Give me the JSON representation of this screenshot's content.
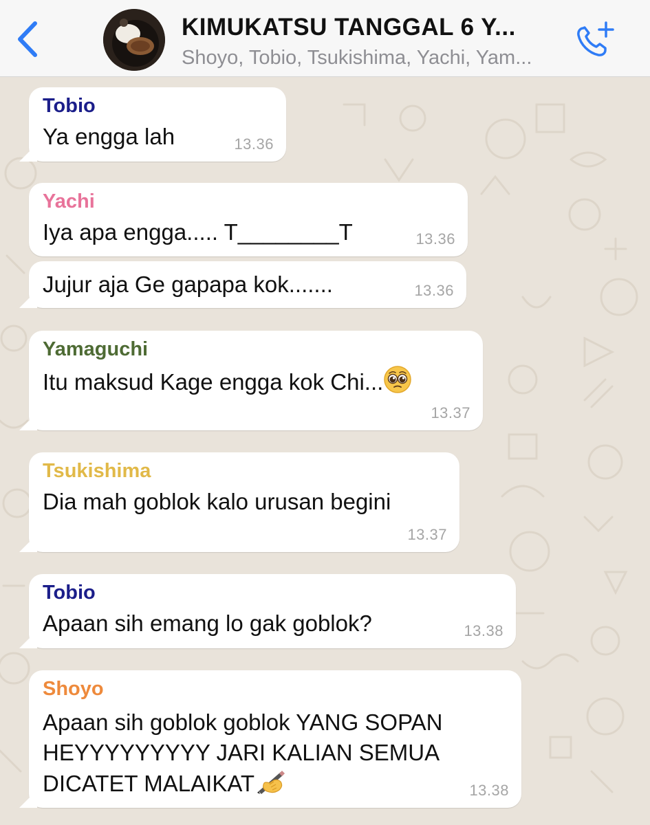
{
  "header": {
    "title": "KIMUKATSU TANGGAL 6 Y...",
    "members": "Shoyo, Tobio, Tsukishima, Yachi, Yam..."
  },
  "colors": {
    "accent": "#2f7cf6",
    "tobio": "#1b1e8a",
    "yachi": "#e8739a",
    "yamaguchi": "#4e6b34",
    "tsukishima": "#e1b948",
    "shoyo": "#ee8a3c"
  },
  "messages": [
    {
      "sender": "Tobio",
      "text": "Ya engga lah",
      "time": "13.36"
    },
    {
      "sender": "Yachi",
      "text": "Iya apa engga..... T________T",
      "time": "13.36"
    },
    {
      "sender": "",
      "text": "Jujur aja Ge gapapa kok.......",
      "time": "13.36"
    },
    {
      "sender": "Yamaguchi",
      "text": "Itu maksud Kage engga kok Chi...",
      "emoji": "pleading-face-icon",
      "time": "13.37"
    },
    {
      "sender": "Tsukishima",
      "text": "Dia mah goblok kalo urusan begini",
      "time": "13.37"
    },
    {
      "sender": "Tobio",
      "text": "Apaan sih emang lo gak goblok?",
      "time": "13.38"
    },
    {
      "sender": "Shoyo",
      "text_lines": [
        "Apaan sih goblok goblok YANG SOPAN",
        "HEYYYYYYYYY JARI KALIAN SEMUA",
        "DICATET MALAIKAT"
      ],
      "emoji": "writing-hand-icon",
      "time": "13.38"
    }
  ]
}
